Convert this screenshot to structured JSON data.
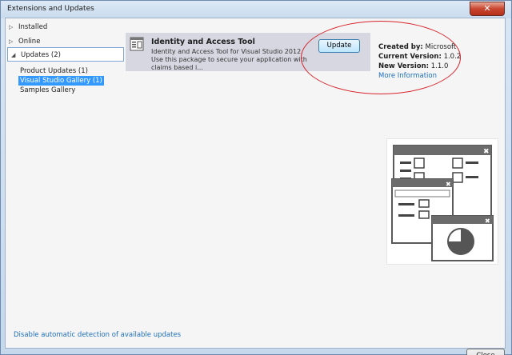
{
  "window": {
    "title": "Extensions and Updates",
    "close_glyph": "✕"
  },
  "sidebar": {
    "items": [
      {
        "label": "Installed",
        "expanded": false
      },
      {
        "label": "Online",
        "expanded": false
      },
      {
        "label": "Updates (2)",
        "expanded": true,
        "selected": true
      }
    ],
    "sub_items": [
      {
        "label": "Product Updates (1)",
        "selected": false
      },
      {
        "label": "Visual Studio Gallery (1)",
        "selected": true
      },
      {
        "label": "Samples Gallery",
        "selected": false
      }
    ]
  },
  "extension": {
    "name": "Identity and Access Tool",
    "description": "Identity and Access Tool for Visual Studio 2012. Use this package to secure your application with claims based i...",
    "update_label": "Update"
  },
  "details": {
    "created_by_label": "Created by:",
    "created_by_value": "Microsoft",
    "current_version_label": "Current Version:",
    "current_version_value": "1.0.2",
    "new_version_label": "New Version:",
    "new_version_value": "1.1.0",
    "more_info": "More Information"
  },
  "footer": {
    "disable_link": "Disable automatic detection of available updates",
    "close_label": "Close"
  },
  "icons": [
    "package-icon",
    "preview-windows-icon",
    "triangle-expand-icon"
  ],
  "colors": {
    "selection": "#3399ff",
    "link": "#1e6fbf",
    "highlight_ellipse": "#d6232a"
  }
}
